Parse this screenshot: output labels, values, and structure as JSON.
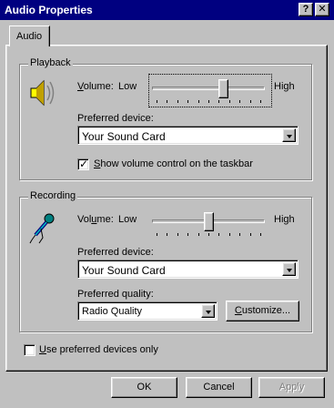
{
  "window": {
    "title": "Audio Properties",
    "help_label": "?",
    "close_label": "✕"
  },
  "tabs": [
    {
      "label": "Audio"
    }
  ],
  "playback": {
    "group_label": "Playback",
    "volume_label_prefix": "V",
    "volume_label_rest": "olume:",
    "low": "Low",
    "high": "High",
    "volume_level_fraction": 0.65,
    "device_label": "Preferred device:",
    "device_value": "Your Sound Card",
    "show_volume_checked": true,
    "show_volume_prefix": "S",
    "show_volume_rest": "how volume control on the taskbar",
    "icon": "speaker-icon"
  },
  "recording": {
    "group_label": "Recording",
    "volume_label_prefix": "Vol",
    "volume_label_underlined": "u",
    "volume_label_rest": "me:",
    "low": "Low",
    "high": "High",
    "volume_level_fraction": 0.5,
    "device_label": "Preferred device:",
    "device_value": "Your Sound Card",
    "quality_label": "Preferred quality:",
    "quality_value": "Radio Quality",
    "customize_prefix": "C",
    "customize_rest": "ustomize...",
    "icon": "microphone-icon"
  },
  "use_preferred": {
    "checked": false,
    "prefix": "U",
    "rest": "se preferred devices only"
  },
  "buttons": {
    "ok": "OK",
    "cancel": "Cancel",
    "apply": "Apply"
  }
}
